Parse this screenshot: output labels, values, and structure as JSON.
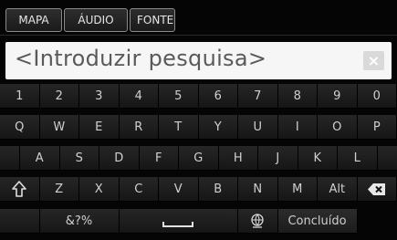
{
  "tabs": [
    {
      "label": "MAPA"
    },
    {
      "label": "ÁUDIO"
    },
    {
      "label": "FONTE"
    }
  ],
  "search": {
    "placeholder": "<Introduzir pesquisa>",
    "clear_label": "×"
  },
  "keyboard": {
    "row1": [
      "1",
      "2",
      "3",
      "4",
      "5",
      "6",
      "7",
      "8",
      "9",
      "0"
    ],
    "row2": [
      "Q",
      "W",
      "E",
      "R",
      "T",
      "Y",
      "U",
      "I",
      "O",
      "P"
    ],
    "row3": [
      "A",
      "S",
      "D",
      "F",
      "G",
      "H",
      "J",
      "K",
      "L"
    ],
    "row4": [
      "Z",
      "X",
      "C",
      "V",
      "B",
      "N",
      "M",
      "Alt"
    ],
    "symbols_label": "&?%",
    "done_label": "Concluído",
    "icons": {
      "shift": "shift-up-arrow-icon",
      "backspace": "backspace-icon",
      "space": "space-bar-icon",
      "language": "globe-language-icon"
    }
  },
  "colors": {
    "background": "#050505",
    "key": "#1e1e1e",
    "key_text": "#d0d0d0",
    "input_bg": "#f6f6f6",
    "input_text": "#5a5a5a"
  }
}
